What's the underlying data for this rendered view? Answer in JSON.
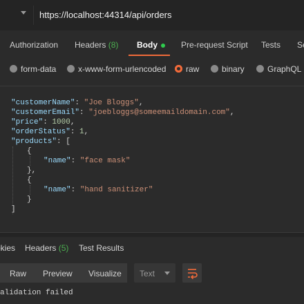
{
  "request": {
    "url": "https://localhost:44314/api/orders"
  },
  "request_tabs": [
    {
      "label": "Authorization"
    },
    {
      "label": "Headers",
      "count": "(8)"
    },
    {
      "label": "Body"
    },
    {
      "label": "Pre-request Script"
    },
    {
      "label": "Tests"
    },
    {
      "label": "Se"
    }
  ],
  "body_types": [
    {
      "label": "form-data"
    },
    {
      "label": "x-www-form-urlencoded"
    },
    {
      "label": "raw"
    },
    {
      "label": "binary"
    },
    {
      "label": "GraphQL"
    }
  ],
  "editor": {
    "lines": {
      "l1": {
        "key": "\"customerName\"",
        "value": "\"Joe Bloggs\""
      },
      "l2": {
        "key": "\"customerEmail\"",
        "value": "\"joebloggs@someemaildomain.com\""
      },
      "l3": {
        "key": "\"price\"",
        "value": "1000"
      },
      "l4": {
        "key": "\"orderStatus\"",
        "value": "1"
      },
      "l5": {
        "key": "\"products\"",
        "value": "["
      },
      "l6": {
        "text": "{"
      },
      "l7": {
        "key": "\"name\"",
        "value": "\"face mask\""
      },
      "l8": {
        "text": "},"
      },
      "l9": {
        "text": "{"
      },
      "l10": {
        "key": "\"name\"",
        "value": "\"hand sanitizer\""
      },
      "l11": {
        "text": "}"
      },
      "l12": {
        "text": "]"
      }
    }
  },
  "response_tabs": [
    {
      "label": "okies"
    },
    {
      "label": "Headers",
      "count": "(5)"
    },
    {
      "label": "Test Results"
    }
  ],
  "response_toolbar": {
    "raw": "Raw",
    "preview": "Preview",
    "visualize": "Visualize",
    "format": "Text"
  },
  "response_body": "alidation failed",
  "colors": {
    "accent": "#f26b3a",
    "count_green": "#4caf50",
    "active_dot": "#2fcc4e"
  },
  "icons": {
    "method_dropdown": "chevron-down-icon",
    "format_dropdown": "chevron-down-icon",
    "wrap": "wrap-lines-icon"
  }
}
